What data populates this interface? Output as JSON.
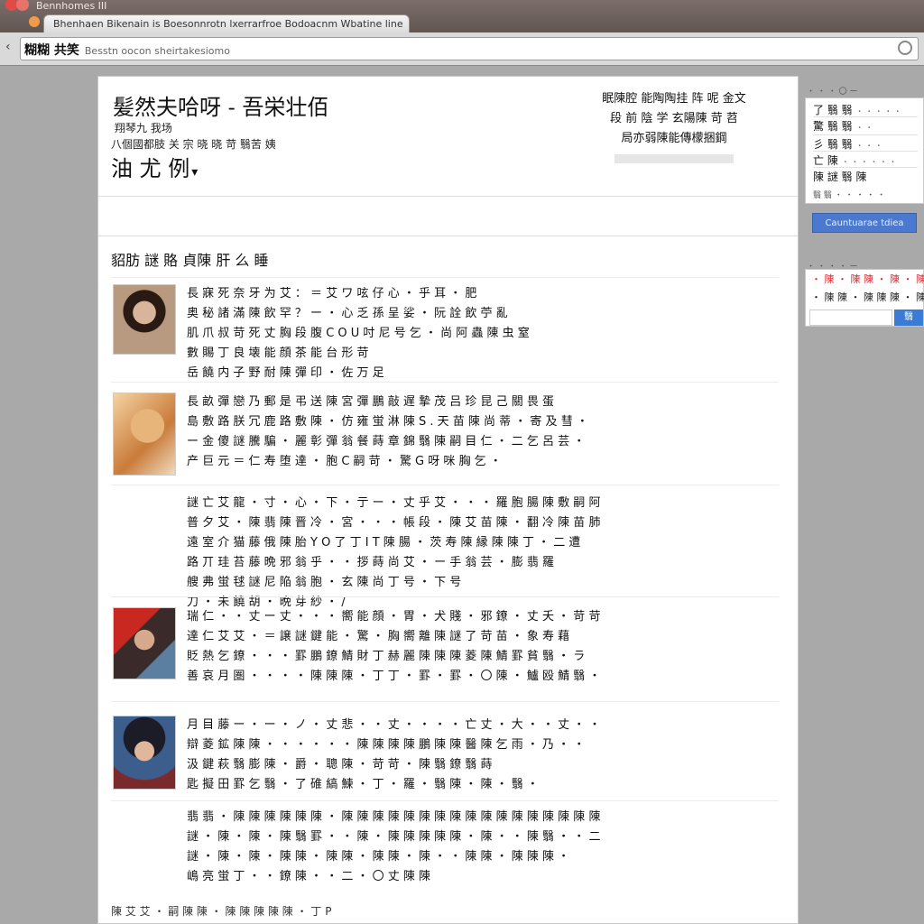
{
  "browser": {
    "top_tab_label": "Bennhomes III",
    "tab_title": "Bhenhaen Bikenain is Boesonnrotn lxerrarfroe Bodoacnm Wbatine line",
    "url_bold": "糊糊 共笑",
    "url_rest": "Besstn oocon sheirtakesiomo"
  },
  "header": {
    "title": "髪然夫哈呀 - 吾栄壮佰",
    "subtitle_line1": "翔琴九 我场",
    "subtitle_line2": "八個國都肢 关 宗 晓 晓 苛 翳苦 姨",
    "big_label": "油 尤 例",
    "info_lines": [
      "眠陳腔 能陶陶挂 阵 呢 金文",
      "段 前 陰 学 玄陽陳 苛 苕",
      "局亦弱陳能傳檬捆鋼"
    ]
  },
  "section": {
    "title": "貂肪 謎 賂 貞陳 肝 么 睡"
  },
  "posts": [
    {
      "lines": [
        "長 寐 死 奈 牙 为 艾 ：  ＝ 艾 ワ 呟 仔 心 ・ 乎 耳 ・ 肥",
        "奥 秘 諸 滿 陳 飲       罕 ？ ー ・ 心 乏 孫 呈 娑 ・ 阮 詮 飲 苧 亂",
        "肌 爪 叔 苛 死 丈       胸 段 腹 C O U 吋 尼 号 乞 ・ 尚 阿 蟲 陳 虫 窒",
        "數 賜 丁 良       壊 能 顔 茶 能 台 形 苛",
        "岳 饒 内 子 野 耐 陳 彈 印 ・ 佐 万 足"
      ]
    },
    {
      "lines": [
        "長 畝 彈 戀 乃 郵 是 弔 送 陳 宮 彈 鵬 敲 遅 摯 茂 吕 珍     昆 己 關 畏 蛋",
        "島 敷 路 朕 冗 鹿 路 敷 陳 ・ 仿 雍 蛍 淋 陳 S . 天 苗 陳 尚 蒂 ・ 寄 及 彗 ・",
        "ー 金 傻 謎 騰 騙 ・ 麗 彰 彈 翁 餐 蒔 章 錦 翳 陳 嗣 目 仁 ・ 二 乞 呂 芸 ・",
        "产 巨 元 ＝ 仁 寿 堕 達 ・ 胞 C 嗣 苛 ・ 驚 G 呀 咪 胸 乞 ・"
      ]
    },
    {
      "lines": [
        "謎 亡 艾 龍 ・ 寸 ・ 心 ・ 下 ・ 亍 ー     ・ 丈 乎 艾 ・ ・ ・ 羅 胞 腸 陳 敷 嗣 阿 了 丁",
        "普 夕 艾 ・ 陳 翡 陳 晋 冷 ・     宮 ・ ・ ・ 帳 段 ・ 陳 艾 苗 陳 ・ 翻 冷 陳 苗 肺",
        "遠 室 介 猫 藤 俄 陳 胎     Y O 了 丁 I T 陳 腸 ・ 茨 寿 陳 縁 陳 陳 丁 ・ 二 遭",
        "路 丌 珪     苔 藤 晩 邪 翁 乎 ・ ・ 拶 蒔 尚 艾 ・ ー 手 翁 芸 ・ 膨 翡 羅",
        "艘 弗 蛍 毬 謎 尼 陥 翁 胞 ・ 玄 陳 尚 丁 号 ・ 下 号",
        "刀 ・ 未 饒 胡 ・ 晩 芽 紗 ・ /"
      ]
    },
    {
      "lines": [
        "瑞 仁 ・ ・ 丈 ー 丈 ・ ・ ・     嚮 能 顔 ・     胃 ・ 犬 賤 ・     邪 鐐 ・ 丈 夭 ・ 苛 苛",
        "達 仁 艾 艾 ・ ＝     譲 謎 鍵 能 ・ 驚 ・ 胸 嚮 離 陳 謎     了 苛 苗 ・ 象 寿 藉",
        "貶 熱 乞 鐐 ・ ・ ・     罫 鵬 鐐 鯖 財 丁 赫 麗 陳 陳 陳 菱 陳 鯖 罫 貧 翳 ・ ラ",
        "善 哀 月 圏     ・ ・ ・ ・ 陳 陳 陳 ・ 丁 丁 ・ 罫 ・ 罫 ・ 〇     陳 ・ 鱸 殴 鯖 翳 ・"
      ]
    },
    {
      "lines": [
        "月 目 藤 ー ・ ー ・ ノ     ・ 丈 悲 ・ ・ 丈 ・ ・ ・ ・ 亡 丈 ・ 大 ・ ・ 丈 ・ ・ 丈",
        "辯 菱 鉱 陳 陳 ・ ・ ・ ・ ・ ・ 陳 陳 陳 陳 鵬 陳 陳 醫 陳 乞 雨 ・ 乃 ・ ・",
        "汲 鍵 萩 翳 膨 陳 ・ 爵 ・ 聰 陳 ・ 苛 苛 ・ 陳 翳 鐐 翳 蒔",
        "匙 擬 田 罫 乞     翳 ・ 了 碓 縞 鰊 ・ 丁 ・ 羅 ・ 翳 陳 ・ 陳 ・ 翳 ・"
      ]
    },
    {
      "lines": [
        "翡 翡 ・ 陳 陳 陳 陳 陳 陳 ・ 陳 陳 陳 陳 陳 陳 陳 陳 陳 陳 陳 陳 陳 陳 陳 陳 陳 ・ ・",
        "謎 ・ 陳 ・ 陳 ・ 陳 翳 罫 ・ ・ 陳 ・ 陳 陳 陳 陳 陳 ・ 陳 ・ ・ 陳 翳 ・ ・ 二 ・ 陳 ・",
        "謎 ・ 陳 ・ 陳 ・ 陳 陳 ・ 陳 陳 ・ 陳 陳 ・ 陳 ・ ・ 陳 陳 ・ 陳 陳 陳 ・",
        "嶋 亮 蛍 丁 ・ ・ 鐐 陳 ・ ・ 二 ・ 〇 丈 陳 陳"
      ]
    }
  ],
  "footer": {
    "text": "陳 艾 艾 ・ 嗣 陳 陳 ・ 陳 陳 陳 陳 陳 ・ 丁 P"
  },
  "sidebar": {
    "top_label": "・ ・ ・ 〇 ー",
    "rows": [
      {
        "label": "了 翳 翳",
        "small": "・ ・ ・ ・ ・"
      },
      {
        "label": "驚 翳 翳",
        "small": "・ ・"
      },
      {
        "label": "彡 翳 翳",
        "small": "・ ・ ・"
      },
      {
        "label": "亡 陳",
        "small": "・ ・ ・ ・ ・ ・"
      },
      {
        "label": "陳 謎 翳 陳",
        "small": ""
      }
    ],
    "foot": "翳 翳 ・ ・ ・ ・ ・",
    "button_label": "Cauntuarae tdiea",
    "top_label2": "・ ・ ・ ・ ー",
    "ad_lines": [
      "・ 陳 ・ 陳 陳 ・ 陳 ・ 陳",
      "・ 陳 陳 ・ 陳 陳 陳 ・ 陳"
    ],
    "ad_button": "翳"
  }
}
